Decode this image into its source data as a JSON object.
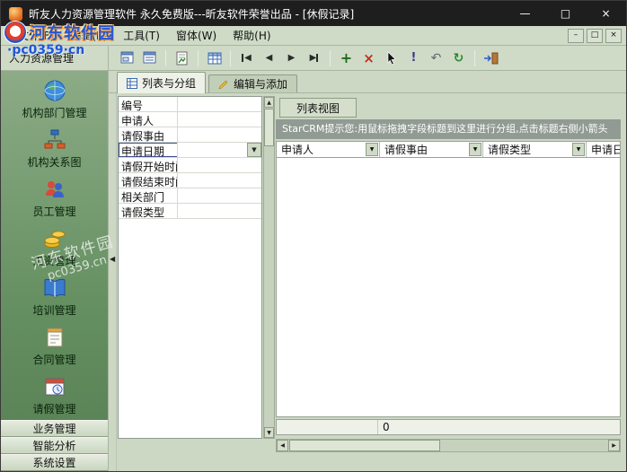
{
  "window": {
    "title": "昕友人力资源管理软件 永久免费版---昕友软件荣誉出品 - [休假记录]",
    "minimize": "—",
    "maximize": "□",
    "close": "×"
  },
  "menu": {
    "items": [
      {
        "label": "文件(F)"
      },
      {
        "label": "编辑(E)"
      },
      {
        "label": "工具(T)"
      },
      {
        "label": "窗体(W)"
      },
      {
        "label": "帮助(H)"
      }
    ],
    "mdi": {
      "minimize": "–",
      "restore": "□",
      "close": "×"
    }
  },
  "glyphs": {
    "up": "▲",
    "down": "▼",
    "left": "◀",
    "right": "▶",
    "plus": "+",
    "cross": "×",
    "excl": "!",
    "undo": "↶",
    "refresh": "↻",
    "dropdown": "▼",
    "collapse_left": "◀"
  },
  "toolbar": {
    "icons": [
      "form-layout-icon",
      "card-layout-icon",
      "report-export-icon",
      "table-grid-icon",
      "first-record-icon",
      "prev-record-icon",
      "next-record-icon",
      "last-record-icon",
      "add-record-icon",
      "delete-record-icon",
      "select-cursor-icon",
      "validate-icon",
      "undo-icon",
      "refresh-icon",
      "exit-icon"
    ]
  },
  "sidebar": {
    "header": "人力资源管理",
    "items": [
      {
        "label": "机构部门管理",
        "icon": "globe-icon"
      },
      {
        "label": "机构关系图",
        "icon": "org-chart-icon"
      },
      {
        "label": "员工管理",
        "icon": "employees-icon"
      },
      {
        "label": "工资管理",
        "icon": "salary-icon"
      },
      {
        "label": "培训管理",
        "icon": "training-icon"
      },
      {
        "label": "合同管理",
        "icon": "contract-icon"
      },
      {
        "label": "请假管理",
        "icon": "leave-icon"
      }
    ],
    "bottom": [
      {
        "label": "业务管理"
      },
      {
        "label": "智能分析"
      },
      {
        "label": "系统设置"
      }
    ]
  },
  "tabs": {
    "items": [
      {
        "label": "列表与分组",
        "active": true
      },
      {
        "label": "编辑与添加",
        "active": false
      }
    ]
  },
  "form": {
    "rows": [
      {
        "label": "编号",
        "value": ""
      },
      {
        "label": "申请人",
        "value": ""
      },
      {
        "label": "请假事由",
        "value": ""
      },
      {
        "label": "申请日期",
        "value": "",
        "selected": true
      },
      {
        "label": "请假开始时间",
        "value": ""
      },
      {
        "label": "请假结束时间",
        "value": ""
      },
      {
        "label": "相关部门",
        "value": ""
      },
      {
        "label": "请假类型",
        "value": ""
      }
    ]
  },
  "list": {
    "tab_label": "列表视图",
    "hint": "StarCRM提示您:用鼠标拖拽字段标题到这里进行分组,点击标题右侧小箭头",
    "columns": [
      {
        "label": "申请人"
      },
      {
        "label": "请假事由"
      },
      {
        "label": "请假类型"
      },
      {
        "label": "申请日期"
      }
    ],
    "count": "0"
  },
  "watermark": {
    "site": "河东软件园",
    "url": "·pc0359·cn",
    "diag_line1": "河东软件园",
    "diag_line2": "pc0359.cn"
  },
  "colors": {
    "titlebar": "#1e1e1e",
    "olive": "#cfdbc7",
    "sidebar_top": "#8cab86",
    "sidebar_bottom": "#577f54",
    "hint_bg": "#919b93",
    "watermark_blue": "#2156d6"
  }
}
